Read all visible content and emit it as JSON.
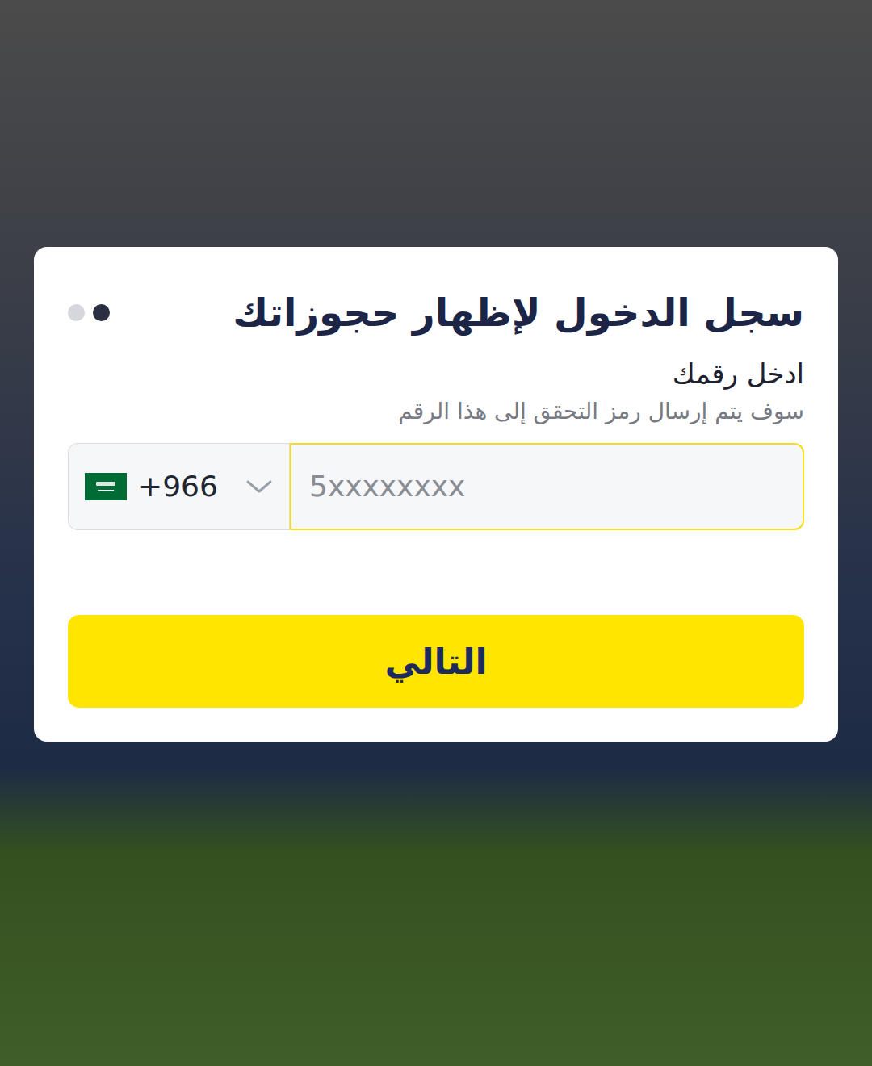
{
  "card": {
    "title": "سجل الدخول لإظهار حجوزاتك",
    "pager": [
      {
        "selected": false
      },
      {
        "selected": true
      }
    ],
    "label": "ادخل رقمك",
    "hint": "سوف يتم إرسال رمز التحقق إلى هذا الرقم"
  },
  "phone": {
    "country_code": "+966",
    "placeholder": "5xxxxxxxx",
    "focused": true
  },
  "button": {
    "label": "التالي"
  }
}
